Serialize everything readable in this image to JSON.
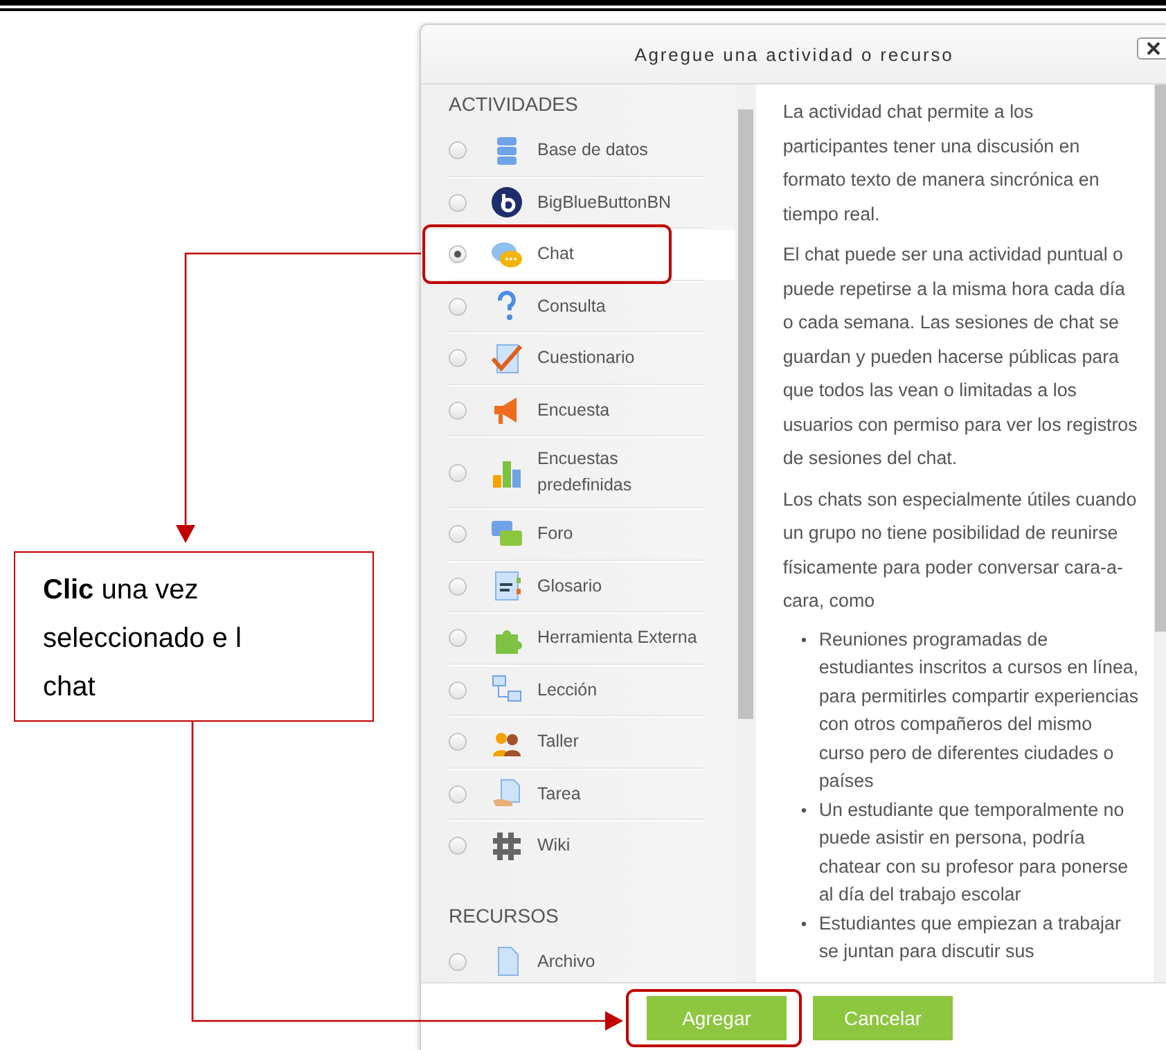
{
  "dialog": {
    "title": "Agregue una actividad o recurso",
    "sections": [
      {
        "heading": "ACTIVIDADES",
        "items": [
          {
            "label": "Base de datos",
            "selected": false,
            "highlighted": false
          },
          {
            "label": "BigBlueButtonBN",
            "selected": false,
            "highlighted": false
          },
          {
            "label": "Chat",
            "selected": true,
            "highlighted": true
          },
          {
            "label": "Consulta",
            "selected": false,
            "highlighted": false
          },
          {
            "label": "Cuestionario",
            "selected": false,
            "highlighted": false
          },
          {
            "label": "Encuesta",
            "selected": false,
            "highlighted": false
          },
          {
            "label": "Encuestas predefinidas",
            "selected": false,
            "highlighted": false
          },
          {
            "label": "Foro",
            "selected": false,
            "highlighted": false
          },
          {
            "label": "Glosario",
            "selected": false,
            "highlighted": false
          },
          {
            "label": "Herramienta Externa",
            "selected": false,
            "highlighted": false
          },
          {
            "label": "Lección",
            "selected": false,
            "highlighted": false
          },
          {
            "label": "Taller",
            "selected": false,
            "highlighted": false
          },
          {
            "label": "Tarea",
            "selected": false,
            "highlighted": false
          },
          {
            "label": "Wiki",
            "selected": false,
            "highlighted": false
          }
        ]
      },
      {
        "heading": "RECURSOS",
        "items": [
          {
            "label": "Archivo",
            "selected": false,
            "highlighted": false
          }
        ]
      }
    ],
    "description": {
      "paragraphs": [
        "La actividad chat permite a los participantes tener una discusión en formato texto de manera sincrónica en tiempo real.",
        "El chat puede ser una actividad puntual o puede repetirse a la misma hora cada día o cada semana. Las sesiones de chat se guardan y pueden hacerse públicas para que todos las vean o limitadas a los usuarios con permiso para ver los registros de sesiones del chat.",
        "Los chats son especialmente útiles cuando un grupo no tiene posibilidad de reunirse físicamente para poder conversar cara-a-cara, como"
      ],
      "bullets": [
        {
          "marker": "•",
          "text": "Reuniones programadas de estudiantes inscritos a cursos en línea, para permitirles compartir experiencias con otros compañeros del mismo curso pero de diferentes ciudades o países"
        },
        {
          "marker": "•",
          "text": "Un estudiante que temporalmente no puede asistir en persona, podría chatear con su profesor para ponerse al día del trabajo escolar"
        },
        {
          "marker": "•",
          "text": "Estudiantes que empiezan a trabajar se juntan para discutir sus"
        }
      ]
    },
    "buttons": [
      {
        "label": "Agregar",
        "highlighted": true
      },
      {
        "label": "Cancelar",
        "highlighted": false
      }
    ]
  },
  "annotation": {
    "callout": "**Clic** una vez seleccionado e l chat"
  }
}
